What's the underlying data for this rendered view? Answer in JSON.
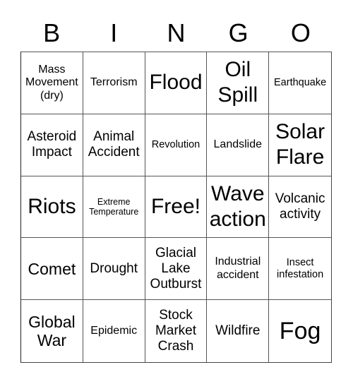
{
  "header": {
    "letters": [
      "B",
      "I",
      "N",
      "G",
      "O"
    ]
  },
  "cells": [
    {
      "text": "Mass Movement (dry)",
      "size": "md"
    },
    {
      "text": "Terrorism",
      "size": "md"
    },
    {
      "text": "Flood",
      "size": "xxl"
    },
    {
      "text": "Oil Spill",
      "size": "xxl"
    },
    {
      "text": "Earthquake",
      "size": "sm"
    },
    {
      "text": "Asteroid Impact",
      "size": "lg"
    },
    {
      "text": "Animal Accident",
      "size": "lg"
    },
    {
      "text": "Revolution",
      "size": "sm"
    },
    {
      "text": "Landslide",
      "size": "md"
    },
    {
      "text": "Solar Flare",
      "size": "xxl"
    },
    {
      "text": "Riots",
      "size": "xxl"
    },
    {
      "text": "Extreme Temperature",
      "size": "xs"
    },
    {
      "text": "Free!",
      "size": "xxl"
    },
    {
      "text": "Wave action",
      "size": "xxl"
    },
    {
      "text": "Volcanic activity",
      "size": "lg"
    },
    {
      "text": "Comet",
      "size": "xl"
    },
    {
      "text": "Drought",
      "size": "lg"
    },
    {
      "text": "Glacial Lake Outburst",
      "size": "lg"
    },
    {
      "text": "Industrial accident",
      "size": "md"
    },
    {
      "text": "Insect infestation",
      "size": "sm"
    },
    {
      "text": "Global War",
      "size": "xl"
    },
    {
      "text": "Epidemic",
      "size": "md"
    },
    {
      "text": "Stock Market Crash",
      "size": "lg"
    },
    {
      "text": "Wildfire",
      "size": "lg"
    },
    {
      "text": "Fog",
      "size": "xxxl"
    }
  ]
}
